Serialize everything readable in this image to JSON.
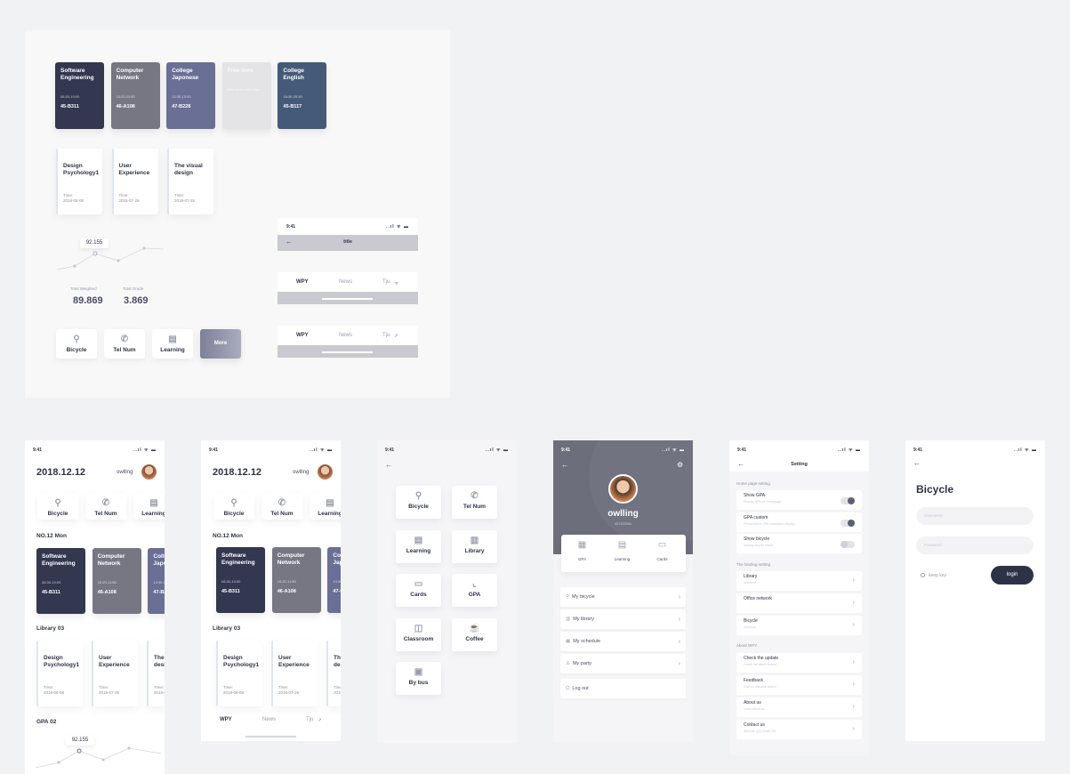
{
  "status_time": "9:41",
  "status_icons": "..ıl ᯤ ▬",
  "courses": [
    {
      "name": "Software Engineering",
      "time": "08:30-10:00",
      "room": "45-B311",
      "color": "#333750"
    },
    {
      "name": "Computer Network",
      "time": "10:20-11:50",
      "room": "46-A108",
      "color": "#777784"
    },
    {
      "name": "College Japonese",
      "time": "13:30-15:00",
      "room": "47-B228",
      "color": "#6a6f96"
    },
    {
      "name": "Free time",
      "time": "Free time class time",
      "room": "",
      "color": "#e4e4e7"
    },
    {
      "name": "College English",
      "time": "18:30-20:30",
      "room": "45-B117",
      "color": "#455a78"
    }
  ],
  "library": [
    {
      "name": "Design Psychology1",
      "time_label": "Time:",
      "date": "2018-08-08"
    },
    {
      "name": "User Experience",
      "time_label": "Time:",
      "date": "2018-07-29"
    },
    {
      "name": "The visual design",
      "time_label": "Time:",
      "date": "2018-07-26"
    }
  ],
  "gpa": {
    "tooltip": "92.155",
    "total_weighted_label": "Total Weighted",
    "total_weighted": "89.869",
    "total_grade_label": "Total Grade",
    "total_grade": "3.869"
  },
  "quick": [
    {
      "label": "Bicycle",
      "icon": "bicycle-icon",
      "glyph": "⚲"
    },
    {
      "label": "Tel Num",
      "icon": "phone-icon",
      "glyph": "✆"
    },
    {
      "label": "Learning",
      "icon": "book-icon",
      "glyph": "▤"
    }
  ],
  "more_label": "More",
  "nav": {
    "back": "←",
    "title": "title"
  },
  "tabs": [
    "WPY",
    "News",
    "Tju"
  ],
  "home": {
    "date": "2018.12.12",
    "user": "owlling",
    "day_label": "NO.12 Mon",
    "library_label": "Library 03",
    "gpa_label": "GPA 02",
    "learning_short": "Learning"
  },
  "grid": [
    {
      "label": "Bicycle",
      "icon": "bicycle-icon",
      "glyph": "⚲"
    },
    {
      "label": "Tel Num",
      "icon": "phone-icon",
      "glyph": "✆"
    },
    {
      "label": "Learning",
      "icon": "book-icon",
      "glyph": "▤"
    },
    {
      "label": "Library",
      "icon": "library-icon",
      "glyph": "▥"
    },
    {
      "label": "Cards",
      "icon": "card-icon",
      "glyph": "▭"
    },
    {
      "label": "GPA",
      "icon": "chart-icon",
      "glyph": "⌞"
    },
    {
      "label": "Classroom",
      "icon": "classroom-icon",
      "glyph": "◫"
    },
    {
      "label": "Coffee",
      "icon": "coffee-icon",
      "glyph": "☕"
    },
    {
      "label": "By bus",
      "icon": "bus-icon",
      "glyph": "▣"
    }
  ],
  "profile": {
    "name": "owlling",
    "id": "4013220kk",
    "stats": [
      "GPA",
      "Learning",
      "Cards"
    ],
    "menu": [
      "My bicycle",
      "My library",
      "My schedule",
      "My party"
    ],
    "logout": "Log out"
  },
  "settings": {
    "title": "Setting",
    "home_section": "Home page setting",
    "home_items": [
      {
        "title": "Show GPA",
        "sub": "Display GPA on homepage",
        "on": true
      },
      {
        "title": "GPA custom",
        "sub": "Personalized GPA calculation display",
        "on": true
      },
      {
        "title": "Show bicycle",
        "sub": "Display bicycle status",
        "on": false
      }
    ],
    "binding_section": "The binding setting",
    "binding_items": [
      {
        "title": "Library",
        "sub": "Unbound"
      },
      {
        "title": "Office network",
        "sub": ""
      },
      {
        "title": "Bicycle",
        "sub": "Unbound"
      }
    ],
    "about_section": "About WPY",
    "about_items": [
      {
        "title": "Check the update",
        "sub": "Check the latest version"
      },
      {
        "title": "Feedback",
        "sub": "Give us valuable advice"
      },
      {
        "title": "About us",
        "sub": "Learn about us"
      },
      {
        "title": "Contact us",
        "sub": "Wechat/ QQ/ Email/ Tel"
      }
    ]
  },
  "login": {
    "title": "Bicycle",
    "username": "Username",
    "password": "Password",
    "keep": "keep key",
    "button": "login"
  }
}
